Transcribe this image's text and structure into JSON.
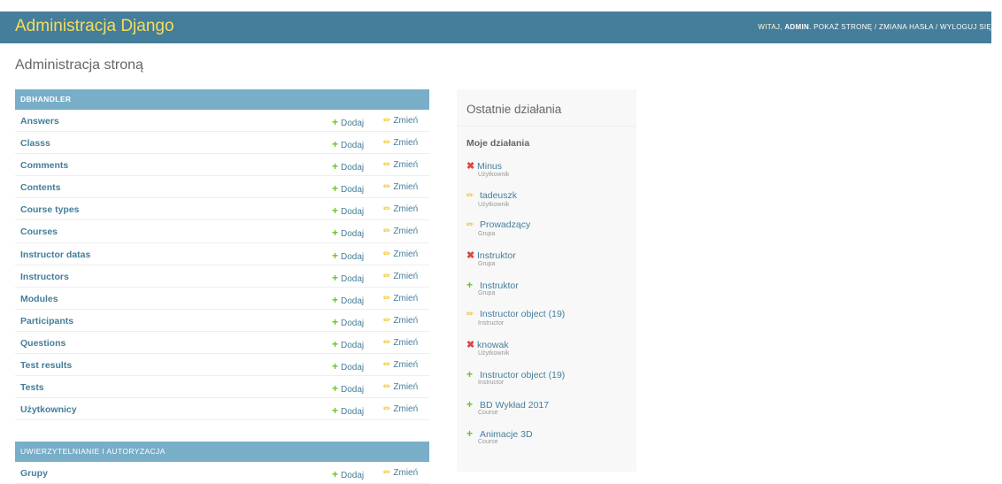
{
  "header": {
    "branding": "Administracja Django",
    "welcome": "WITAJ,",
    "user": "ADMIN",
    "dot": ".",
    "view_site": "POKAŻ STRONĘ",
    "sep1": "/",
    "change_password": "ZMIANA HASŁA",
    "sep2": "/",
    "logout": "WYLOGUJ SIĘ"
  },
  "page_title": "Administracja stroną",
  "labels": {
    "add": "Dodaj",
    "change": "Zmień"
  },
  "colors": {
    "header_bg": "#447e9b",
    "caption_bg": "#79aec8",
    "branding": "#f5dd5d",
    "add_icon": "#70bf2b",
    "change_icon": "#efb80b",
    "delete_icon": "#dd4646"
  },
  "apps": [
    {
      "caption": "DBHANDLER",
      "models": [
        "Answers",
        "Classs",
        "Comments",
        "Contents",
        "Course types",
        "Courses",
        "Instructor datas",
        "Instructors",
        "Modules",
        "Participants",
        "Questions",
        "Test results",
        "Tests",
        "Użytkownicy"
      ]
    },
    {
      "caption": "UWIERZYTELNIANIE I AUTORYZACJA",
      "models": [
        "Grupy"
      ]
    }
  ],
  "recent": {
    "title": "Ostatnie działania",
    "subtitle": "Moje działania",
    "actions": [
      {
        "icon": "delete-icon",
        "text": "Minus",
        "type": "Użytkownik"
      },
      {
        "icon": "pencil-icon",
        "text": "tadeuszk",
        "type": "Użytkownik"
      },
      {
        "icon": "pencil-icon",
        "text": "Prowadzący",
        "type": "Grupa"
      },
      {
        "icon": "delete-icon",
        "text": "Instruktor",
        "type": "Grupa"
      },
      {
        "icon": "add-icon",
        "text": "Instruktor",
        "type": "Grupa"
      },
      {
        "icon": "pencil-icon",
        "text": "Instructor object (19)",
        "type": "Instructor"
      },
      {
        "icon": "delete-icon",
        "text": "knowak",
        "type": "Użytkownik"
      },
      {
        "icon": "add-icon",
        "text": "Instructor object (19)",
        "type": "Instructor"
      },
      {
        "icon": "add-icon",
        "text": "BD Wykład 2017",
        "type": "Course"
      },
      {
        "icon": "add-icon",
        "text": "Animacje 3D",
        "type": "Course"
      }
    ]
  }
}
